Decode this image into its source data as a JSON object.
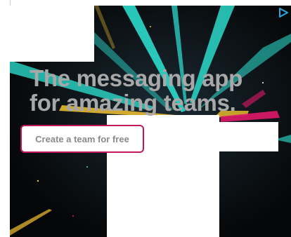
{
  "ad": {
    "headline_line1": "The messaging app",
    "headline_line2": "for amazing teams.",
    "cta_label": "Create a team for free",
    "adchoices_icon": "play-triangle-icon",
    "colors": {
      "background": "#050607",
      "cta_border": "#c2185b",
      "headline": "#a8a8a8",
      "beam_cyan": "#2ee6d6",
      "beam_yellow": "#f2c230",
      "beam_pink": "#e0186a",
      "adchoices": "#29a9e1"
    }
  }
}
